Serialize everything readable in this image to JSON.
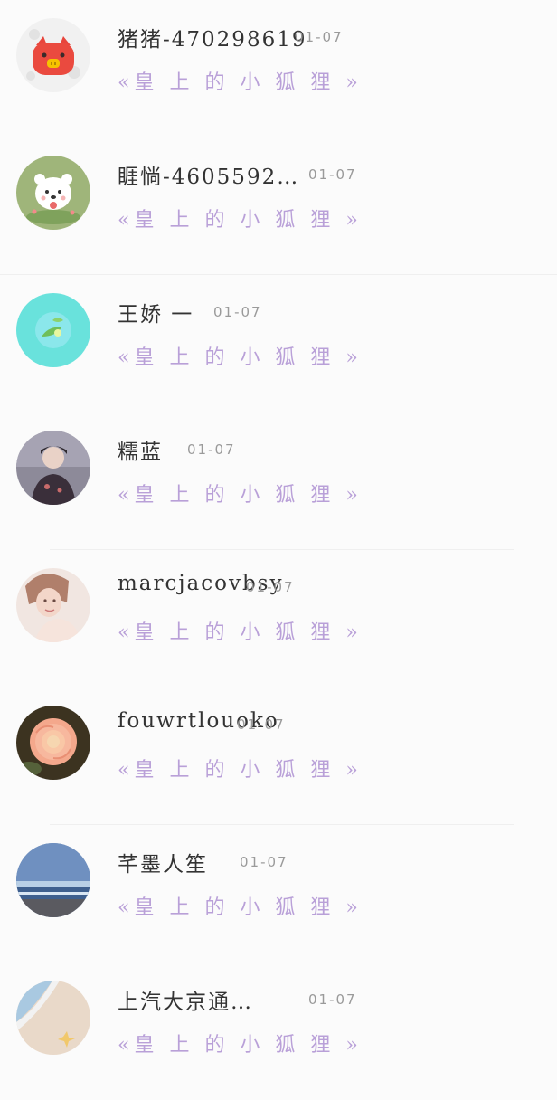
{
  "conversations": [
    {
      "name": "猪猪-470298619",
      "time": "01-07",
      "message": "«皇 上 的 小 狐 狸 »",
      "avatar_icon": "pig-face-icon"
    },
    {
      "name": "睚惝-4605592…",
      "time": "01-07",
      "message": "«皇 上 的 小 狐 狸 »",
      "avatar_icon": "bear-cartoon-icon"
    },
    {
      "name": "王娇 一",
      "time": "01-07",
      "message": "«皇 上 的 小 狐 狸 »",
      "avatar_icon": "leaf-cup-icon"
    },
    {
      "name": "糯蓝",
      "time": "01-07",
      "message": "«皇 上 的 小 狐 狸 »",
      "avatar_icon": "person-photo-icon"
    },
    {
      "name": "marcjacovbsy",
      "time": "01-07",
      "message": "«皇 上 的 小 狐 狸 »",
      "avatar_icon": "portrait-photo-icon"
    },
    {
      "name": "fouwrtlouoko",
      "time": "01-07",
      "message": "«皇 上 的 小 狐 狸 »",
      "avatar_icon": "rose-photo-icon"
    },
    {
      "name": "芊墨人笙",
      "time": "01-07",
      "message": "«皇 上 的 小 狐 狸 »",
      "avatar_icon": "sea-photo-icon"
    },
    {
      "name": "上汽大京通…",
      "time": "01-07",
      "message": "«皇 上 的 小 狐 狸 »",
      "avatar_icon": "beach-photo-icon"
    }
  ],
  "colors": {
    "name_text": "#333333",
    "time_text": "#9a9a9a",
    "message_text": "#b9a0d8",
    "background": "#fbfbfb"
  }
}
